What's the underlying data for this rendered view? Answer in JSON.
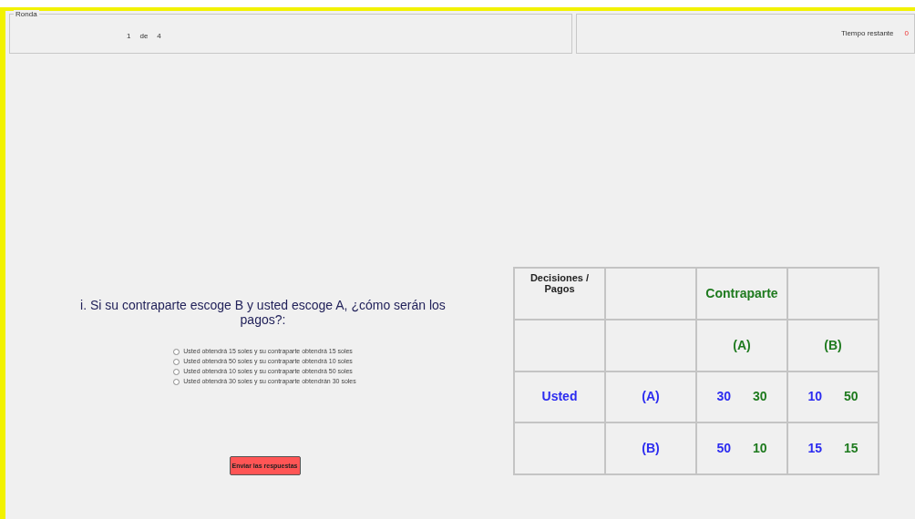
{
  "round_panel": {
    "legend": "Ronda",
    "current": "1",
    "separator": "de",
    "total": "4"
  },
  "timer_panel": {
    "label": "Tiempo restante",
    "value": "0"
  },
  "question": "i. Si su contraparte escoge B y usted escoge A, ¿cómo serán los pagos?:",
  "options": [
    {
      "label": "Usted obtendrá 15 soles y su contraparte obtendrá 15 soles",
      "selected": false
    },
    {
      "label": "Usted obtendrá 50 soles y su contraparte obtendrá 10 soles",
      "selected": false
    },
    {
      "label": "Usted obtendrá 10 soles y su contraparte obtendrá 50 soles",
      "selected": false
    },
    {
      "label": "Usted obtendrá 30 soles y su contraparte obtendrán 30 soles",
      "selected": false
    }
  ],
  "submit_button": "Enviar las respuestas",
  "payoff_table": {
    "rows": [
      [
        {
          "values": [
            {
              "text": "Decisiones / Pagos",
              "color": "#222222"
            }
          ]
        },
        {},
        {
          "values": [
            {
              "text": "Contraparte",
              "color": "#1e7a1e"
            }
          ]
        },
        {}
      ],
      [
        {},
        {},
        {
          "values": [
            {
              "text": "(A)",
              "color": "#1e7a1e"
            }
          ]
        },
        {
          "values": [
            {
              "text": "(B)",
              "color": "#1e7a1e"
            }
          ]
        }
      ],
      [
        {
          "values": [
            {
              "text": "Usted",
              "color": "#2b2bf0"
            }
          ]
        },
        {
          "values": [
            {
              "text": "(A)",
              "color": "#2b2bf0"
            }
          ]
        },
        {
          "values": [
            {
              "text": "30",
              "color": "#2b2bf0"
            },
            {
              "text": "30",
              "color": "#1e7a1e"
            }
          ]
        },
        {
          "values": [
            {
              "text": "10",
              "color": "#2b2bf0"
            },
            {
              "text": "50",
              "color": "#1e7a1e"
            }
          ]
        }
      ],
      [
        {},
        {
          "values": [
            {
              "text": "(B)",
              "color": "#2b2bf0"
            }
          ]
        },
        {
          "values": [
            {
              "text": "50",
              "color": "#2b2bf0"
            },
            {
              "text": "10",
              "color": "#1e7a1e"
            }
          ]
        },
        {
          "values": [
            {
              "text": "15",
              "color": "#2b2bf0"
            },
            {
              "text": "15",
              "color": "#1e7a1e"
            }
          ]
        }
      ]
    ]
  }
}
